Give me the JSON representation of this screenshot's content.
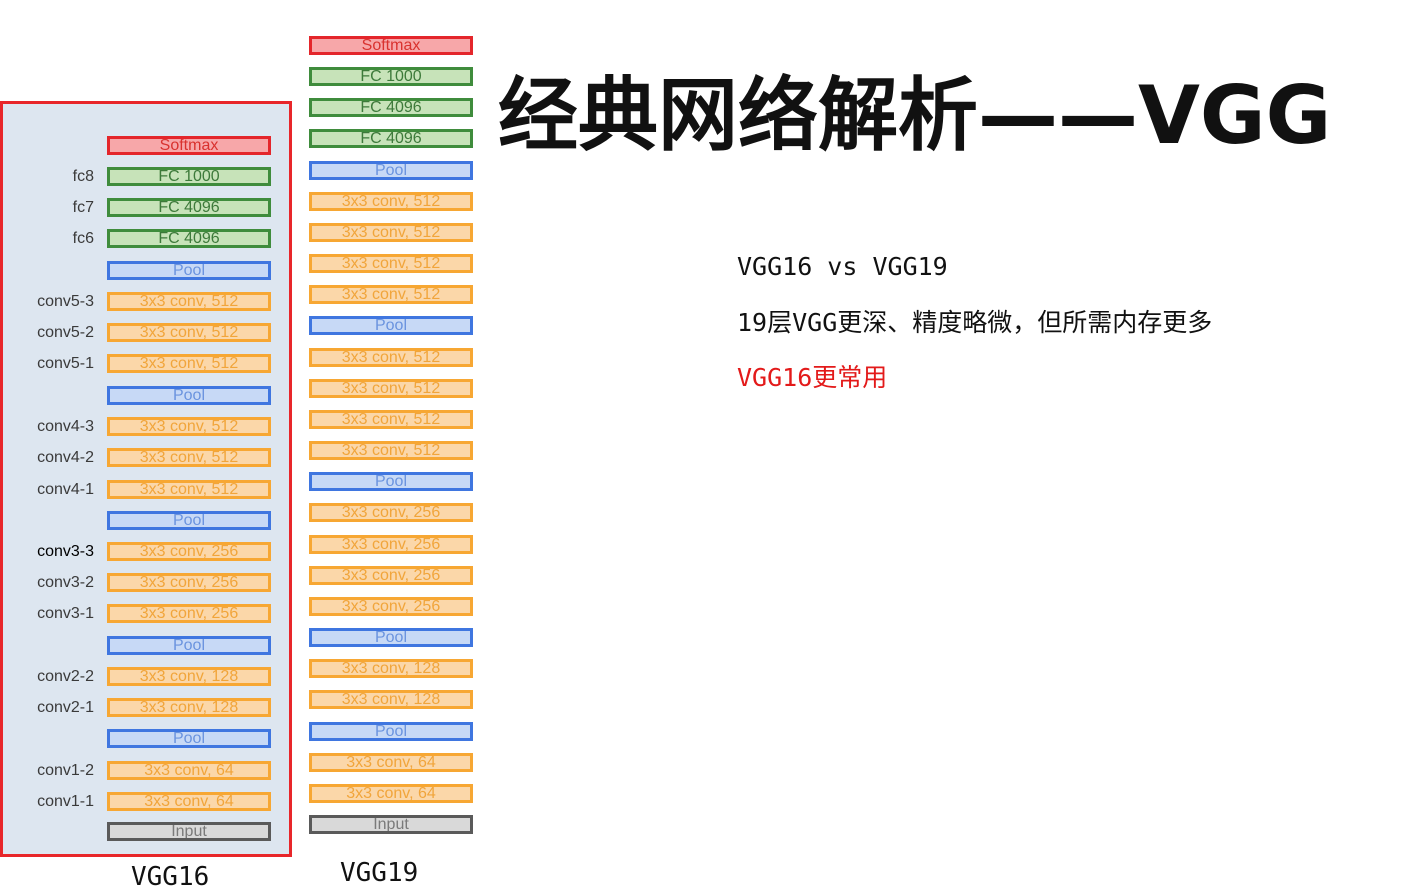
{
  "title": "经典网络解析——VGG",
  "notes": {
    "line1": "VGG16 vs VGG19",
    "line2": "19层VGG更深、精度略微，但所需内存更多",
    "line3": "VGG16更常用"
  },
  "colors": {
    "panel_border": "#e8262a",
    "panel_background": "#dde6f0",
    "softmax": "#e4262b",
    "fc": "#3f8c3c",
    "pool": "#3f76e0",
    "conv": "#f7a733",
    "input": "#5a5a5a",
    "highlight_text": "#e31a1a"
  },
  "vgg16": {
    "caption": "VGG16",
    "layers": [
      {
        "type": "softmax",
        "text": "Softmax",
        "label": ""
      },
      {
        "type": "fc",
        "text": "FC 1000",
        "label": "fc8"
      },
      {
        "type": "fc",
        "text": "FC 4096",
        "label": "fc7"
      },
      {
        "type": "fc",
        "text": "FC 4096",
        "label": "fc6"
      },
      {
        "type": "pool",
        "text": "Pool",
        "label": ""
      },
      {
        "type": "conv",
        "text": "3x3 conv, 512",
        "label": "conv5-3"
      },
      {
        "type": "conv",
        "text": "3x3 conv, 512",
        "label": "conv5-2"
      },
      {
        "type": "conv",
        "text": "3x3 conv, 512",
        "label": "conv5-1"
      },
      {
        "type": "pool",
        "text": "Pool",
        "label": ""
      },
      {
        "type": "conv",
        "text": "3x3 conv, 512",
        "label": "conv4-3"
      },
      {
        "type": "conv",
        "text": "3x3 conv, 512",
        "label": "conv4-2"
      },
      {
        "type": "conv",
        "text": "3x3 conv, 512",
        "label": "conv4-1"
      },
      {
        "type": "pool",
        "text": "Pool",
        "label": ""
      },
      {
        "type": "conv",
        "text": "3x3 conv, 256",
        "label": "conv3-3"
      },
      {
        "type": "conv",
        "text": "3x3 conv, 256",
        "label": "conv3-2"
      },
      {
        "type": "conv",
        "text": "3x3 conv, 256",
        "label": "conv3-1"
      },
      {
        "type": "pool",
        "text": "Pool",
        "label": ""
      },
      {
        "type": "conv",
        "text": "3x3 conv, 128",
        "label": "conv2-2"
      },
      {
        "type": "conv",
        "text": "3x3 conv, 128",
        "label": "conv2-1"
      },
      {
        "type": "pool",
        "text": "Pool",
        "label": ""
      },
      {
        "type": "conv",
        "text": "3x3 conv, 64",
        "label": "conv1-2"
      },
      {
        "type": "conv",
        "text": "3x3 conv, 64",
        "label": "conv1-1"
      },
      {
        "type": "input",
        "text": "Input",
        "label": ""
      }
    ]
  },
  "vgg19": {
    "caption": "VGG19",
    "layers": [
      {
        "type": "softmax",
        "text": "Softmax"
      },
      {
        "type": "fc",
        "text": "FC 1000"
      },
      {
        "type": "fc",
        "text": "FC 4096"
      },
      {
        "type": "fc",
        "text": "FC 4096"
      },
      {
        "type": "pool",
        "text": "Pool"
      },
      {
        "type": "conv",
        "text": "3x3 conv, 512"
      },
      {
        "type": "conv",
        "text": "3x3 conv, 512"
      },
      {
        "type": "conv",
        "text": "3x3 conv, 512"
      },
      {
        "type": "conv",
        "text": "3x3 conv, 512"
      },
      {
        "type": "pool",
        "text": "Pool"
      },
      {
        "type": "conv",
        "text": "3x3 conv, 512"
      },
      {
        "type": "conv",
        "text": "3x3 conv, 512"
      },
      {
        "type": "conv",
        "text": "3x3 conv, 512"
      },
      {
        "type": "conv",
        "text": "3x3 conv, 512"
      },
      {
        "type": "pool",
        "text": "Pool"
      },
      {
        "type": "conv",
        "text": "3x3 conv, 256"
      },
      {
        "type": "conv",
        "text": "3x3 conv, 256"
      },
      {
        "type": "conv",
        "text": "3x3 conv, 256"
      },
      {
        "type": "conv",
        "text": "3x3 conv, 256"
      },
      {
        "type": "pool",
        "text": "Pool"
      },
      {
        "type": "conv",
        "text": "3x3 conv, 128"
      },
      {
        "type": "conv",
        "text": "3x3 conv, 128"
      },
      {
        "type": "pool",
        "text": "Pool"
      },
      {
        "type": "conv",
        "text": "3x3 conv, 64"
      },
      {
        "type": "conv",
        "text": "3x3 conv, 64"
      },
      {
        "type": "input",
        "text": "Input"
      }
    ]
  }
}
